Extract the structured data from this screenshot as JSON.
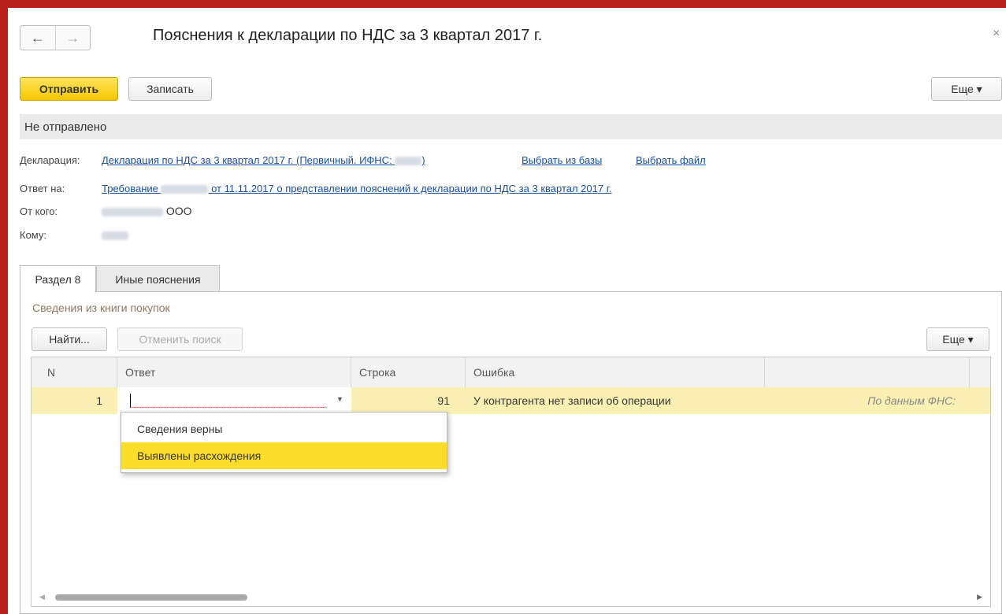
{
  "window": {
    "title": "Пояснения к декларации по НДС за 3 квартал 2017 г.",
    "back_icon": "←",
    "forward_icon": "→",
    "close_icon": "×"
  },
  "toolbar": {
    "send_label": "Отправить",
    "save_label": "Записать",
    "more_label": "Еще ▾"
  },
  "status_text": "Не отправлено",
  "fields": {
    "declaration_label": "Декларация:",
    "declaration_link_part1": "Декларация по НДС за 3 квартал 2017 г. (Первичный. ИФНС: ",
    "declaration_link_part2": ")",
    "choose_from_db": "Выбрать из базы",
    "choose_file": "Выбрать файл",
    "answer_to_label": "Ответ на:",
    "answer_link_part1": "Требование ",
    "answer_link_part2": " от 11.11.2017 о представлении пояснений к декларации по НДС за 3 квартал 2017 г.",
    "from_label": "От кого:",
    "from_value_suffix": "ООО",
    "to_label": "Кому:"
  },
  "tabs": [
    {
      "label": "Раздел 8"
    },
    {
      "label": "Иные пояснения"
    }
  ],
  "panel": {
    "section_title": "Сведения из книги покупок",
    "find_label": "Найти...",
    "cancel_search_label": "Отменить поиск",
    "more_label": "Еще ▾"
  },
  "table": {
    "columns": [
      "N",
      "Ответ",
      "Строка",
      "Ошибка",
      ""
    ],
    "rows": [
      {
        "n": "1",
        "answer": "",
        "line": "91",
        "error": "У контрагента нет записи об операции",
        "extra": "По данным ФНС:"
      }
    ]
  },
  "dropdown": {
    "options": [
      "Сведения верны",
      "Выявлены расхождения"
    ],
    "highlighted_index": 1
  },
  "colors": {
    "frame": "#b8201c",
    "accent_yellow": "#f5c800",
    "row_highlight": "#fbf0b4",
    "option_highlight": "#fddd2c",
    "link": "#1a4fa0"
  }
}
